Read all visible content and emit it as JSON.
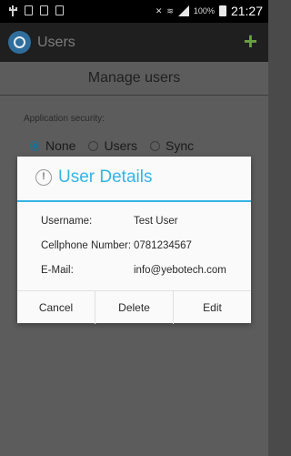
{
  "status_bar": {
    "battery_text": "100%",
    "time": "21:27"
  },
  "action_bar": {
    "title": "Users",
    "add_glyph": "+"
  },
  "page": {
    "title": "Manage users",
    "security_label": "Application security:",
    "radio_options": [
      {
        "label": "None",
        "selected": true
      },
      {
        "label": "Users",
        "selected": false
      },
      {
        "label": "Sync",
        "selected": false
      }
    ]
  },
  "dialog": {
    "title": "User Details",
    "fields": [
      {
        "label": "Username:",
        "value": "Test User"
      },
      {
        "label": "Cellphone Number:",
        "value": "0781234567"
      },
      {
        "label": "E-Mail:",
        "value": "info@yebotech.com"
      }
    ],
    "buttons": {
      "cancel": "Cancel",
      "delete": "Delete",
      "edit": "Edit"
    }
  },
  "colors": {
    "accent": "#33b5e5",
    "add_button": "#6aa23a",
    "radio_selected": "#1f6e93"
  }
}
